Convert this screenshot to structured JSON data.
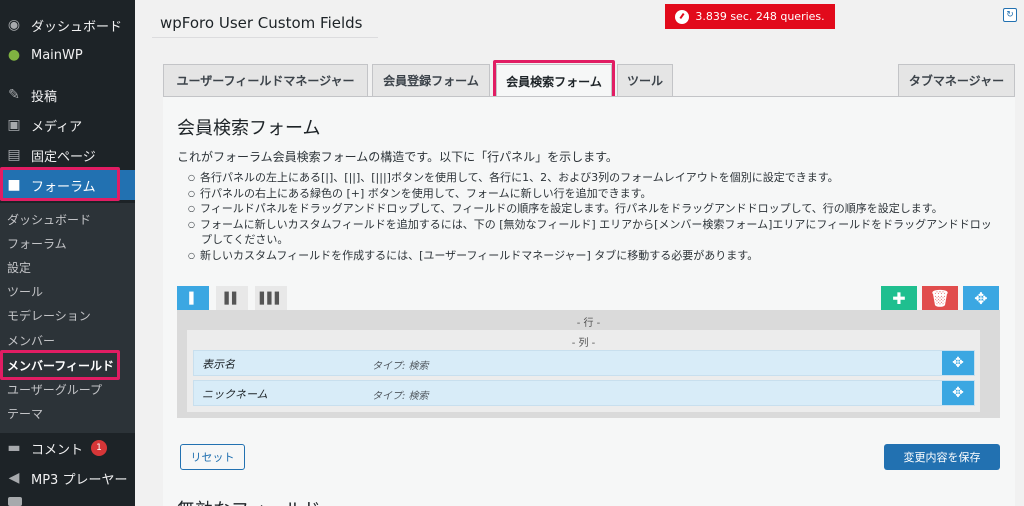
{
  "sidebar": {
    "menu": [
      {
        "label": "ダッシュボード",
        "icon": "dashboard-icon"
      },
      {
        "label": "MainWP",
        "icon": "mainwp-icon"
      },
      {
        "label": "投稿",
        "icon": "pin-icon"
      },
      {
        "label": "メディア",
        "icon": "media-icon"
      },
      {
        "label": "固定ページ",
        "icon": "page-icon"
      },
      {
        "label": "フォーラム",
        "icon": "forum-icon"
      }
    ],
    "submenu": [
      "ダッシュボード",
      "フォーラム",
      "設定",
      "ツール",
      "モデレーション",
      "メンバー",
      "メンバーフィールド",
      "ユーザーグループ",
      "テーマ"
    ],
    "comments": {
      "label": "コメント",
      "count": "1"
    },
    "mp3": {
      "label": "MP3 プレーヤー"
    }
  },
  "header": {
    "title": "wpForo User Custom Fields",
    "perf": "3.839 sec. 248 queries."
  },
  "tabs": [
    "ユーザーフィールドマネージャー",
    "会員登録フォーム",
    "会員検索フォーム",
    "ツール",
    "タブマネージャー"
  ],
  "main": {
    "title": "会員検索フォーム",
    "description": "これがフォーラム会員検索フォームの構造です。以下に「行パネル」を示します。",
    "bullets": [
      "各行パネルの左上にある[|]、[||]、[|||]ボタンを使用して、各行に1、2、および3列のフォームレイアウトを個別に設定できます。",
      "行パネルの右上にある緑色の [+] ボタンを使用して、フォームに新しい行を追加できます。",
      "フィールドパネルをドラッグアンドドロップして、フィールドの順序を設定します。行パネルをドラッグアンドドロップして、行の順序を設定します。",
      "フォームに新しいカスタムフィールドを追加するには、下の [無効なフィールド] エリアから[メンバー検索フォーム]エリアにフィールドをドラッグアンドドロッ",
      "プしてください。",
      "新しいカスタムフィールドを作成するには、[ユーザーフィールドマネージャー] タブに移動する必要があります。"
    ],
    "row_label": "- 行 -",
    "col_label": "- 列 -",
    "fields": [
      {
        "name": "表示名",
        "type": "タイプ: 検索"
      },
      {
        "name": "ニックネーム",
        "type": "タイプ: 検索"
      }
    ],
    "reset_label": "リセット",
    "save_label": "変更内容を保存",
    "next_heading": "無効なフィールド"
  },
  "colors": {
    "accent": "#2271b1",
    "highlight": "#e11d63",
    "add": "#1fbf8f",
    "delete": "#e14d4d",
    "move": "#3ba7e2"
  }
}
